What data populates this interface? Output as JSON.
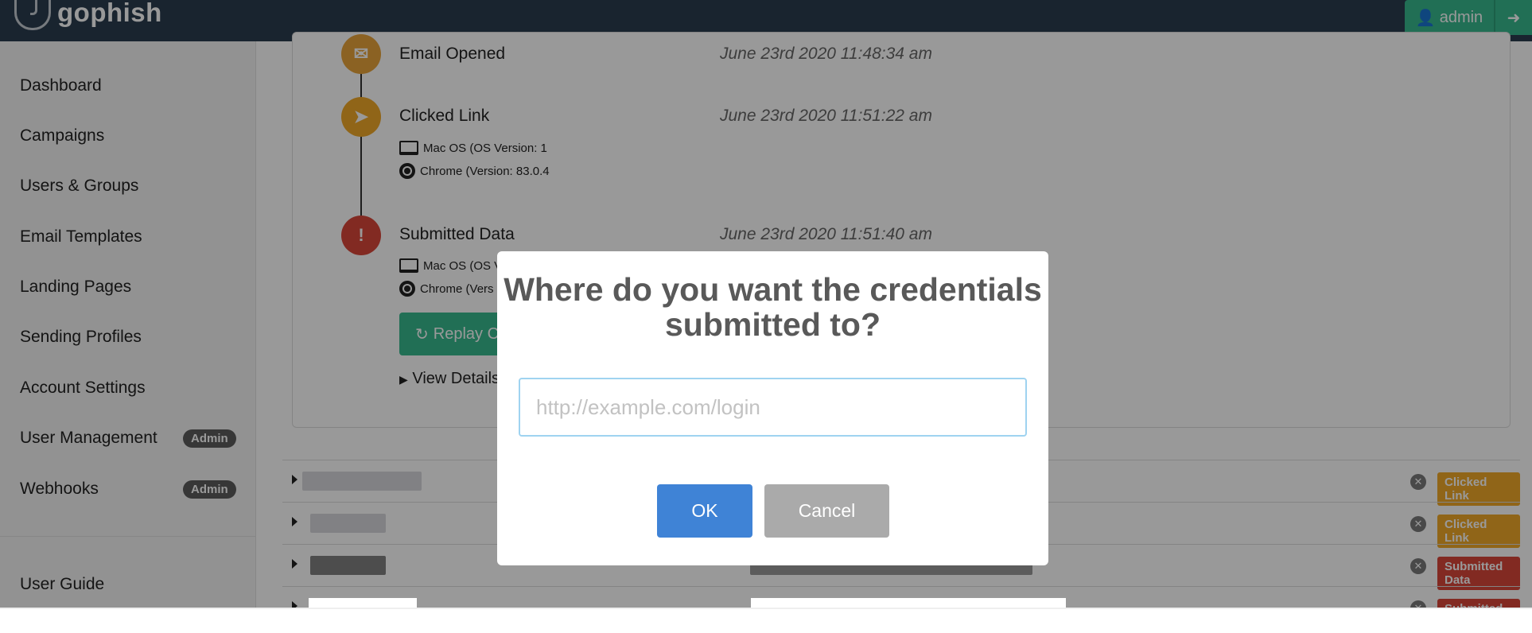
{
  "app": {
    "name": "gophish",
    "user": "admin"
  },
  "sidebar": {
    "items": [
      {
        "label": "Dashboard"
      },
      {
        "label": "Campaigns"
      },
      {
        "label": "Users & Groups"
      },
      {
        "label": "Email Templates"
      },
      {
        "label": "Landing Pages"
      },
      {
        "label": "Sending Profiles"
      },
      {
        "label": "Account Settings"
      },
      {
        "label": "User Management",
        "badge": "Admin"
      },
      {
        "label": "Webhooks",
        "badge": "Admin"
      }
    ],
    "guide": "User Guide"
  },
  "timeline": [
    {
      "title": "Email Opened",
      "time": "June 23rd 2020 11:48:34 am",
      "color": "#e8a43b",
      "icon": "envelope-open-icon"
    },
    {
      "title": "Clicked Link",
      "time": "June 23rd 2020 11:51:22 am",
      "color": "#f0a828",
      "icon": "mouse-pointer-icon",
      "os": "Mac OS (OS Version: 1",
      "browser": "Chrome (Version: 83.0.4"
    },
    {
      "title": "Submitted Data",
      "time": "June 23rd 2020 11:51:40 am",
      "color": "#d9463a",
      "icon": "exclamation-icon",
      "os": "Mac OS (OS V",
      "browser": "Chrome (Vers"
    }
  ],
  "actions": {
    "replay": "Replay Cr",
    "view_details": "View Details"
  },
  "results": [
    {
      "status": "Clicked Link",
      "color": "#f0a828"
    },
    {
      "status": "Clicked Link",
      "color": "#f0a828"
    },
    {
      "status": "Submitted Data",
      "color": "#d9463a"
    },
    {
      "status": "Submitted Data",
      "color": "#d9463a"
    }
  ],
  "modal": {
    "title": "Where do you want the credentials submitted to?",
    "input_placeholder": "http://example.com/login",
    "ok_label": "OK",
    "cancel_label": "Cancel"
  }
}
